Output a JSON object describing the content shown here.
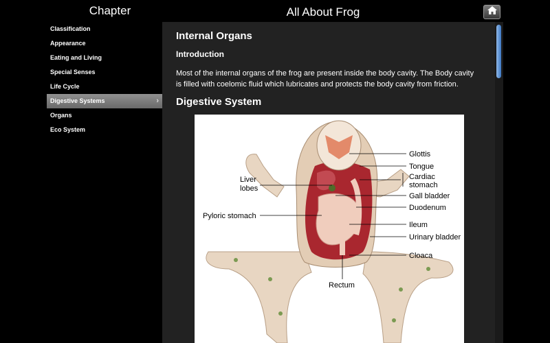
{
  "sidebar": {
    "title": "Chapter",
    "items": [
      {
        "label": "Classification"
      },
      {
        "label": "Appearance"
      },
      {
        "label": "Eating and Living"
      },
      {
        "label": "Special Senses"
      },
      {
        "label": "Life Cycle"
      },
      {
        "label": "Digestive Systems"
      },
      {
        "label": "Organs"
      },
      {
        "label": "Eco System"
      }
    ],
    "selected_index": 5
  },
  "header": {
    "title": "All About Frog",
    "home_icon": "home-icon"
  },
  "content": {
    "heading": "Internal Organs",
    "subheading": "Introduction",
    "paragraph": "Most of the internal organs of the frog are present inside the body cavity. The Body cavity is filled with coelomic fluid which lubricates and protects the body cavity from friction.",
    "section_heading": "Digestive System",
    "figure_labels": {
      "glottis": "Glottis",
      "tongue": "Tongue",
      "liver_lobes_1": "Liver",
      "liver_lobes_2": "lobes",
      "cardiac_1": "Cardiac",
      "cardiac_2": "stomach",
      "gall_bladder": "Gall bladder",
      "duodenum": "Duodenum",
      "pyloric": "Pyloric stomach",
      "ileum": "Ileum",
      "urinary": "Urinary bladder",
      "cloaca": "Cloaca",
      "rectum": "Rectum"
    }
  },
  "colors": {
    "accent_scroll": "#3d78c4",
    "selected_bg": "#7a7a7a",
    "content_bg": "#222222"
  }
}
